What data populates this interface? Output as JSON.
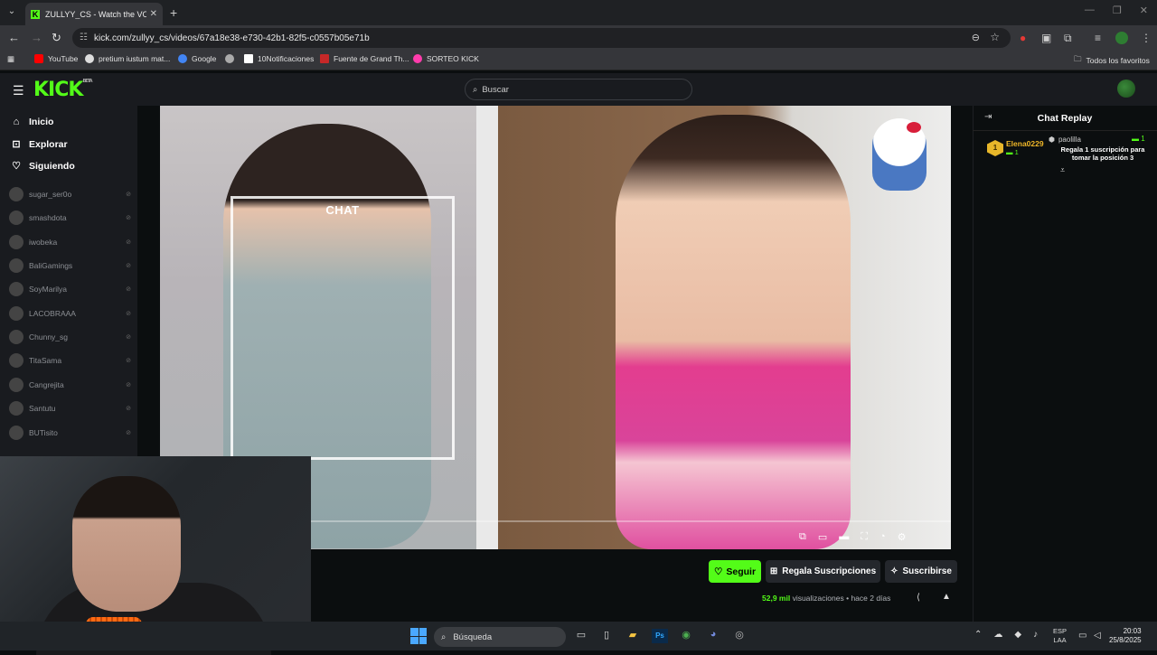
{
  "browser": {
    "tab_title": "ZULLYY_CS - Watch the VOD o",
    "url": "kick.com/zullyy_cs/videos/67a18e38-e730-42b1-82f5-c0557b05e71b",
    "bookmarks": [
      {
        "label": "YouTube",
        "color": "#ff0000"
      },
      {
        "label": "pretium iustum mat...",
        "color": "#dddddd"
      },
      {
        "label": "Google",
        "color": "#4285f4"
      },
      {
        "label": "",
        "color": "#aaaaaa"
      },
      {
        "label": "10Notificaciones",
        "color": "#ffffff"
      },
      {
        "label": "Fuente de Grand Th...",
        "color": "#c62828"
      },
      {
        "label": "SORTEO KICK",
        "color": "#ff3cac"
      }
    ],
    "all_bookmarks": "Todos los favoritos"
  },
  "kick": {
    "logo": "KICK",
    "beta": "BETA",
    "search_placeholder": "Buscar",
    "nav": [
      {
        "label": "Inicio",
        "icon": "home-icon"
      },
      {
        "label": "Explorar",
        "icon": "compass-icon"
      },
      {
        "label": "Siguiendo",
        "icon": "heart-icon"
      }
    ],
    "channels": [
      {
        "name": "sugar_ser0o"
      },
      {
        "name": "smashdota"
      },
      {
        "name": "iwobeka"
      },
      {
        "name": "BaliGamings"
      },
      {
        "name": "SoyMarilya"
      },
      {
        "name": "LACOBRAAA"
      },
      {
        "name": "Chunny_sg"
      },
      {
        "name": "TitaSama"
      },
      {
        "name": "Cangrejita"
      },
      {
        "name": "Santutu"
      },
      {
        "name": "BUTisito"
      }
    ]
  },
  "video": {
    "overlay_text": "CHAT"
  },
  "actions": {
    "follow": "Seguir",
    "gift": "Regala Suscripciones",
    "subscribe": "Suscribirse",
    "views_count": "52,9 mil",
    "views_label": "visualizaciones",
    "time_ago": "hace 2 días"
  },
  "chat": {
    "title": "Chat Replay",
    "top_gifter_rank": "1",
    "top_gifter_name": "Elena0229",
    "top_gifter_count": "1",
    "gift_user": "paolilla",
    "gift_user_count": "1",
    "gift_message": "Regala 1 suscripción para tomar la posición 3"
  },
  "taskbar": {
    "search": "Búsqueda",
    "lang_line1": "ESP",
    "lang_line2": "LAA",
    "time": "20:03",
    "date": "25/8/2025"
  }
}
